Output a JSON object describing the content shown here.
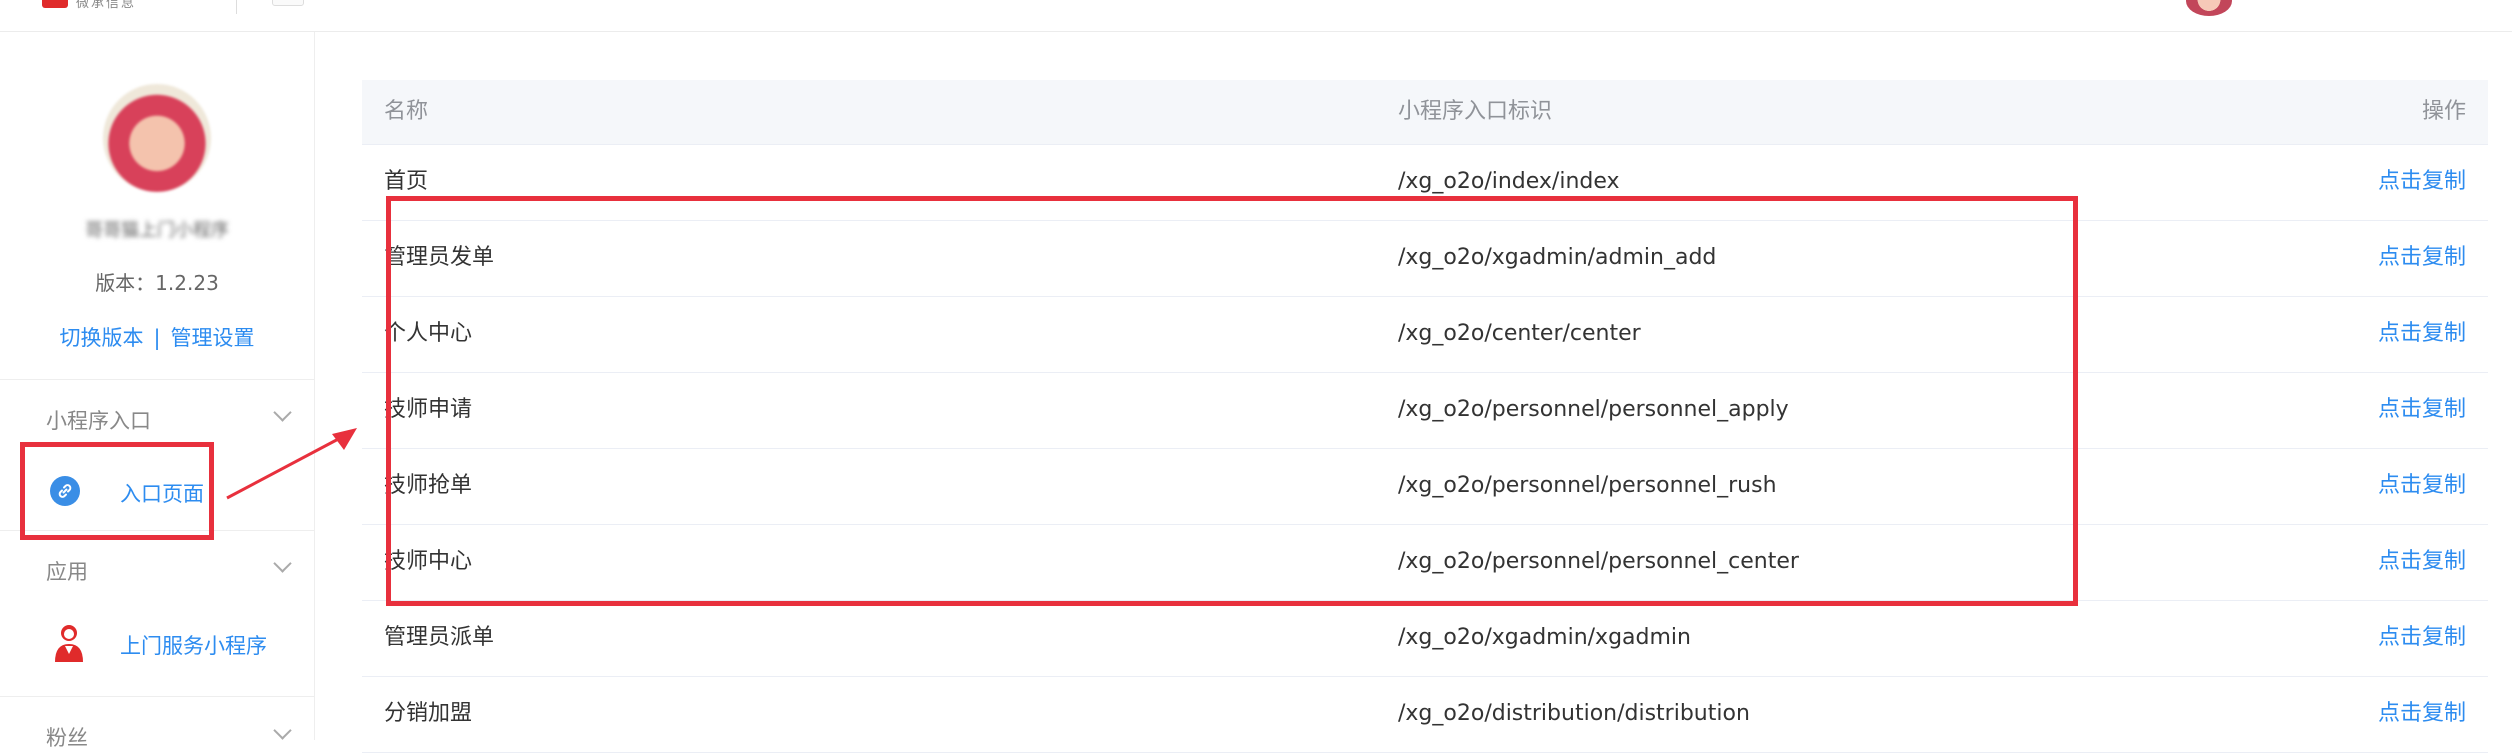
{
  "header": {
    "logo_text": "微承信息"
  },
  "sidebar": {
    "app_name": "哥哥猫上门小程序",
    "version": "版本：1.2.23",
    "switch_version": "切换版本",
    "link_separator": "|",
    "manage_settings": "管理设置",
    "sections": [
      {
        "title": "小程序入口",
        "items": [
          {
            "label": "入口页面"
          }
        ]
      },
      {
        "title": "应用",
        "items": [
          {
            "label": "上门服务小程序"
          }
        ]
      },
      {
        "title": "粉丝",
        "items": []
      }
    ]
  },
  "table": {
    "headers": {
      "name": "名称",
      "path": "小程序入口标识",
      "op": "操作"
    },
    "rows": [
      {
        "name": "首页",
        "path": "/xg_o2o/index/index",
        "op": "点击复制"
      },
      {
        "name": "管理员发单",
        "path": "/xg_o2o/xgadmin/admin_add",
        "op": "点击复制"
      },
      {
        "name": "个人中心",
        "path": "/xg_o2o/center/center",
        "op": "点击复制"
      },
      {
        "name": "技师申请",
        "path": "/xg_o2o/personnel/personnel_apply",
        "op": "点击复制"
      },
      {
        "name": "技师抢单",
        "path": "/xg_o2o/personnel/personnel_rush",
        "op": "点击复制"
      },
      {
        "name": "技师中心",
        "path": "/xg_o2o/personnel/personnel_center",
        "op": "点击复制"
      },
      {
        "name": "管理员派单",
        "path": "/xg_o2o/xgadmin/xgadmin",
        "op": "点击复制"
      },
      {
        "name": "分销加盟",
        "path": "/xg_o2o/distribution/distribution",
        "op": "点击复制"
      }
    ]
  },
  "colors": {
    "accent": "#2d8cf0",
    "annotation": "#e8303d",
    "header_bg": "#f5f7fa"
  },
  "icons": [
    "link-icon",
    "person-icon",
    "chevron-down-icon"
  ]
}
